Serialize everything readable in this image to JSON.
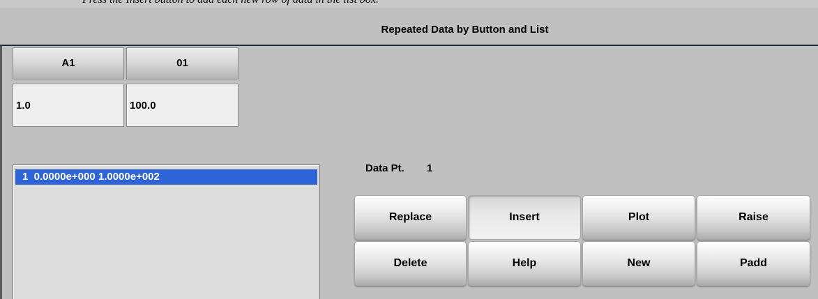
{
  "top_strip": {
    "text": "Press the Insert button to add each new row of data in the list box."
  },
  "window": {
    "title": "Repeated Data by Button and List"
  },
  "table": {
    "headers": [
      "A1",
      "01"
    ],
    "values": [
      "1.0",
      "100.0"
    ]
  },
  "list": {
    "items": [
      "1  0.0000e+000 1.0000e+002"
    ]
  },
  "data_point": {
    "label": "Data Pt.",
    "value": "1"
  },
  "buttons": {
    "replace": "Replace",
    "insert": "Insert",
    "plot": "Plot",
    "raise": "Raise",
    "delete": "Delete",
    "help": "Help",
    "new": "New",
    "padd": "Padd"
  },
  "colors": {
    "selection": "#2f64d8",
    "title_rule": "#1f2b3a",
    "background": "#c0c0c0"
  }
}
